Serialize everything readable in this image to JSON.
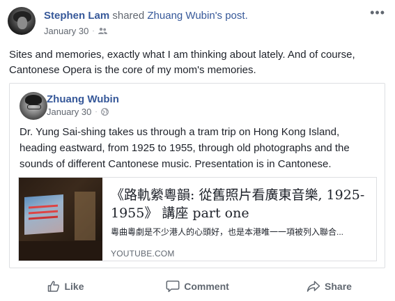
{
  "post": {
    "author": "Stephen Lam",
    "shared_text": " shared ",
    "original_author": "Zhuang Wubin",
    "post_suffix": "'s post.",
    "date": "January 30",
    "privacy_icon": "friends-icon",
    "more_label": "•••",
    "status": "Sites and memories, exactly what I am thinking about lately. And of course, Cantonese Opera is the core of my mom's memories."
  },
  "shared_post": {
    "author": "Zhuang Wubin",
    "date": "January 30",
    "privacy_icon": "globe-icon",
    "text": "Dr. Yung Sai-shing takes us through a tram trip on Hong Kong Island, heading eastward, from 1925 to 1955, through old photographs and the sounds of different Cantonese music. Presentation is in Cantonese.",
    "link": {
      "title": "《路軌縈粵韻: 從舊照片看廣東音樂, 1925-1955》 講座 part one",
      "description": "粵曲粵劇是不少港人的心頭好，也是本港唯一一項被列入聯合...",
      "domain": "YOUTUBE.COM"
    }
  },
  "actions": {
    "like": "Like",
    "comment": "Comment",
    "share": "Share"
  },
  "colors": {
    "link_blue": "#365899",
    "meta_gray": "#616770",
    "text": "#1d2129",
    "border": "#dddfe2"
  }
}
